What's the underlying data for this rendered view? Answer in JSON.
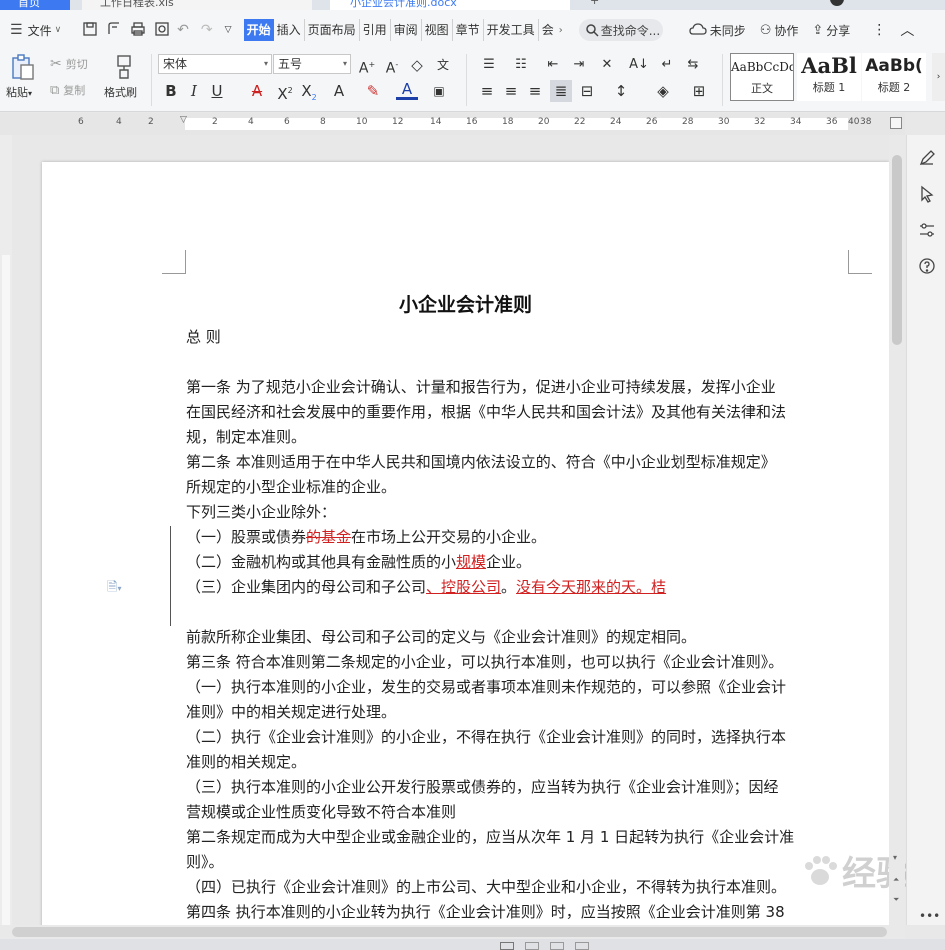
{
  "tabs": {
    "home": "首页",
    "tab1": "工作日程表.xls",
    "tab2": "小企业会计准则.docx",
    "new": "+"
  },
  "menu": {
    "file": "文件",
    "items": [
      "开始",
      "插入",
      "页面布局",
      "引用",
      "审阅",
      "视图",
      "章节",
      "开发工具",
      "会"
    ],
    "search": "查找命令...",
    "unsynced": "未同步",
    "collab": "协作",
    "share": "分享"
  },
  "ribbon": {
    "paste": "粘贴",
    "cut": "剪切",
    "copy": "复制",
    "format_painter": "格式刷",
    "font_name": "宋体",
    "font_size": "五号",
    "styles": [
      {
        "sample": "AaBbCcDd",
        "name": "正文"
      },
      {
        "sample": "AaBl",
        "name": "标题 1"
      },
      {
        "sample": "AaBb(",
        "name": "标题 2"
      }
    ]
  },
  "ruler": {
    "numbers": [
      "6",
      "4",
      "2",
      "2",
      "4",
      "6",
      "8",
      "10",
      "12",
      "14",
      "16",
      "18",
      "20",
      "22",
      "24",
      "26",
      "28",
      "30",
      "32",
      "34",
      "36",
      "38",
      "40"
    ]
  },
  "document": {
    "title": "小企业会计准则",
    "heading": "总  则",
    "lines": [
      "第一条  为了规范小企业会计确认、计量和报告行为，促进小企业可持续发展，发挥小企业",
      "在国民经济和社会发展中的重要作用，根据《中华人民共和国会计法》及其他有关法律和法",
      "规，制定本准则。",
      "第二条  本准则适用于在中华人民共和国境内依法设立的、符合《中小企业划型标准规定》",
      "所规定的小型企业标准的企业。",
      "下列三类小企业除外："
    ],
    "item1": {
      "a": "（一）股票或债券",
      "del": "的基金",
      "b": "在市场上公开交易的小企业。"
    },
    "item2": {
      "a": "（二）金融机构或其他具有金融性质的小",
      "ins": "规模",
      "b": "企业。"
    },
    "item3": {
      "a": "（三）企业集团内的母公司和子公司",
      "ins1": "、控股公司",
      "b": "。",
      "ins2": "没有今天那来的天。桔"
    },
    "lines2": [
      "前款所称企业集团、母公司和子公司的定义与《企业会计准则》的规定相同。",
      "第三条  符合本准则第二条规定的小企业，可以执行本准则，也可以执行《企业会计准则》。",
      "（一）执行本准则的小企业，发生的交易或者事项本准则未作规范的，可以参照《企业会计",
      "准则》中的相关规定进行处理。",
      "（二）执行《企业会计准则》的小企业，不得在执行《企业会计准则》的同时，选择执行本",
      "准则的相关规定。",
      "（三）执行本准则的小企业公开发行股票或债券的，应当转为执行《企业会计准则》；因经",
      "营规模或企业性质变化导致不符合本准则",
      "第二条规定而成为大中型企业或金融企业的，应当从次年 1 月 1 日起转为执行《企业会计准",
      "则》。",
      "（四）已执行《企业会计准则》的上市公司、大中型企业和小企业，不得转为执行本准则。",
      "第四条  执行本准则的小企业转为执行《企业会计准则》时，应当按照《企业会计准则第 38"
    ]
  },
  "watermark": "经验"
}
